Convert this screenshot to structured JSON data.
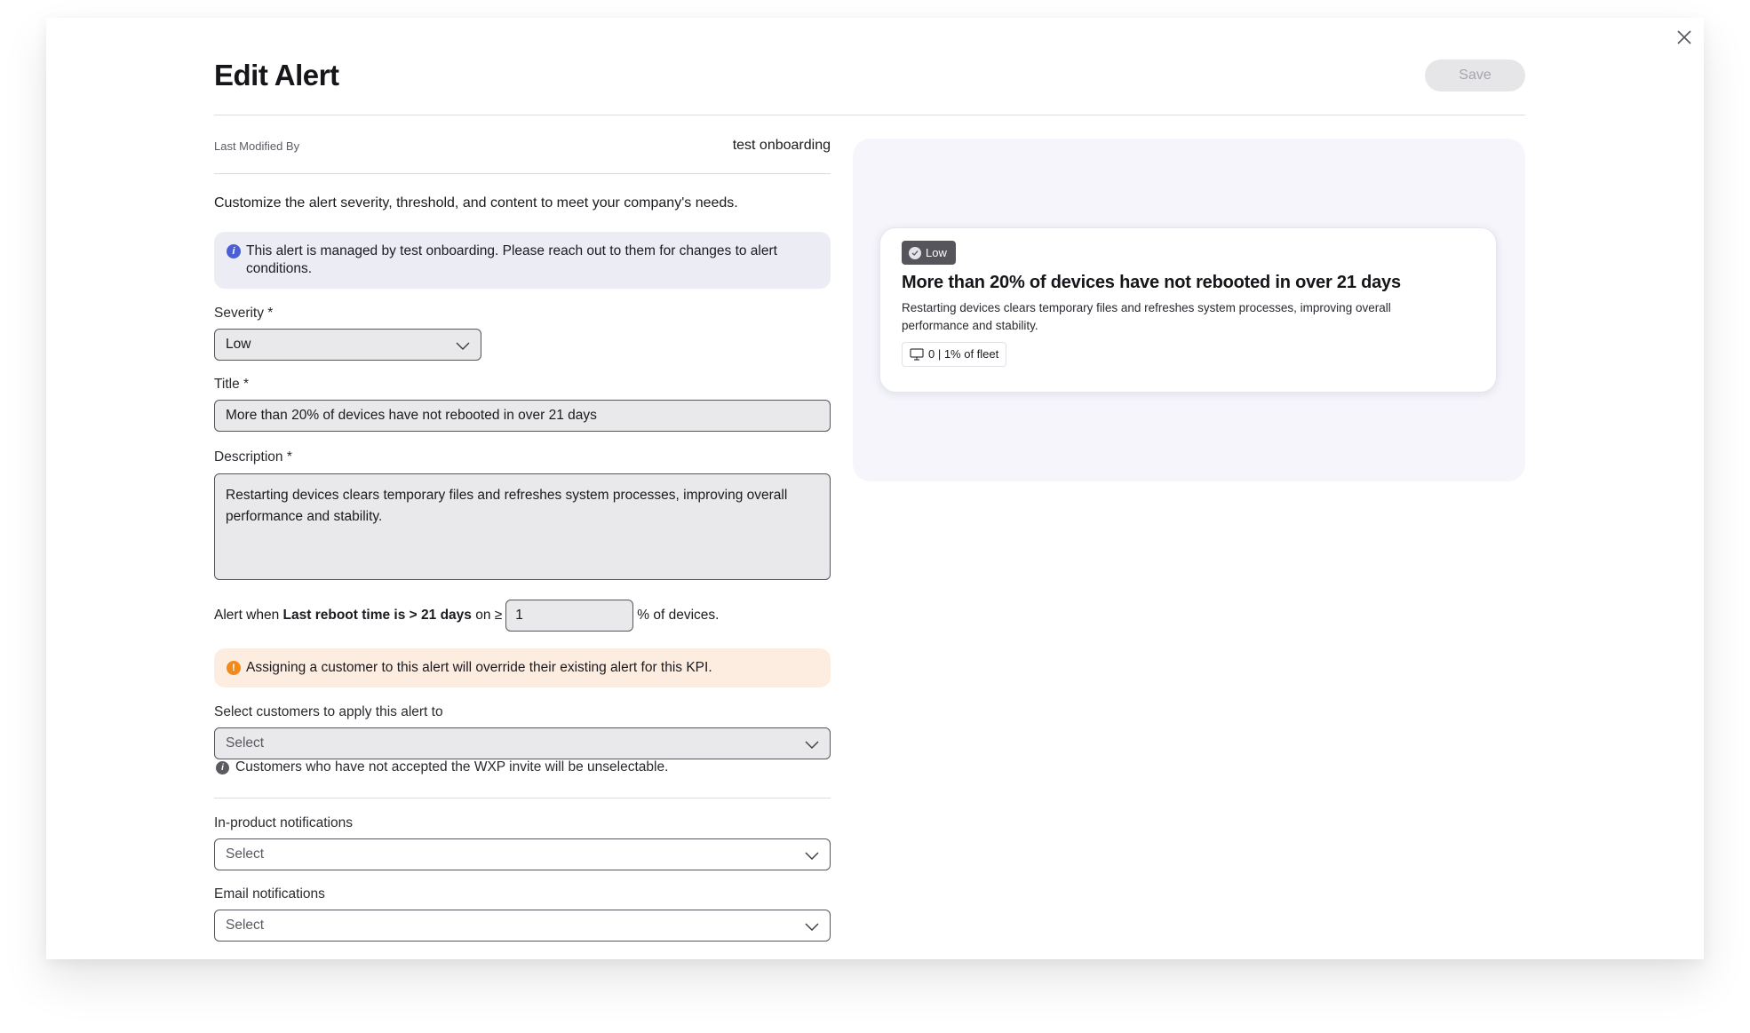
{
  "header": {
    "title": "Edit Alert",
    "save_label": "Save"
  },
  "meta": {
    "last_modified_label": "Last Modified By",
    "last_modified_value": "test onboarding"
  },
  "intro": "Customize the alert severity, threshold, and content to meet your company's needs.",
  "info_banner": {
    "icon": "info-icon",
    "text": "This alert is managed by test onboarding. Please reach out to them for changes to alert conditions."
  },
  "form": {
    "severity_label": "Severity *",
    "severity_value": "Low",
    "title_label": "Title *",
    "title_value": "More than 20% of devices have not rebooted in over 21 days",
    "description_label": "Description *",
    "description_value": "Restarting devices clears temporary files and refreshes system processes, improving overall performance and stability.",
    "threshold": {
      "prefix": "Alert when",
      "condition": "Last reboot time is > 21 days",
      "on": "on ≥",
      "value": "1",
      "suffix": "% of devices."
    },
    "warning": "Assigning a customer to this alert will override their existing alert for this KPI.",
    "customers_label": "Select customers to apply this alert to",
    "customers_placeholder": "Select",
    "customers_hint": "Customers who have not accepted the WXP invite will be unselectable.",
    "in_product_label": "In-product notifications",
    "in_product_placeholder": "Select",
    "email_label": "Email notifications",
    "email_placeholder": "Select"
  },
  "preview": {
    "severity": "Low",
    "title": "More than 20% of devices have not rebooted in over 21 days",
    "description": "Restarting devices clears temporary files and refreshes system processes, improving overall performance and stability.",
    "fleet": "0 | 1% of fleet"
  },
  "colors": {
    "info_icon": "#4a5fd6",
    "warning_icon": "#f08a1c",
    "warning_bg": "#fdece0",
    "info_bg": "#ececf4",
    "preview_bg": "#f5f5fb",
    "badge_bg": "#55555b"
  }
}
